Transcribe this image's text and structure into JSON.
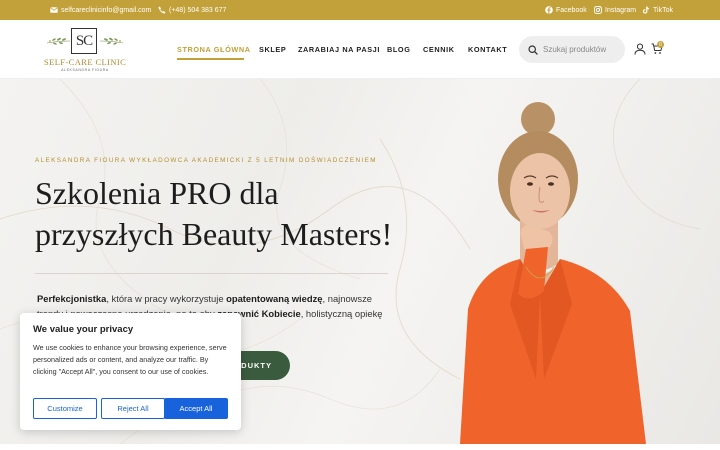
{
  "topbar": {
    "email": "selfcareclinicinfo@gmail.com",
    "phone": "(+48) 504 383 677",
    "social": [
      {
        "label": "Facebook",
        "icon": "facebook-icon"
      },
      {
        "label": "Instagram",
        "icon": "instagram-icon"
      },
      {
        "label": "TikTok",
        "icon": "tiktok-icon"
      }
    ]
  },
  "header": {
    "logo": {
      "monogram": "SC",
      "name": "SELF-CARE CLINIC",
      "sub": "ALEKSANDRA FIOURA"
    },
    "nav": [
      {
        "label": "STRONA GŁÓWNA",
        "active": true
      },
      {
        "label": "SKLEP"
      },
      {
        "label": "ZARABIAJ NA PASJI"
      },
      {
        "label": "BLOG"
      },
      {
        "label": "CENNIK"
      },
      {
        "label": "KONTAKT"
      }
    ],
    "search_placeholder": "Szukaj produktów",
    "cart_count": "0"
  },
  "hero": {
    "eyebrow": "ALEKSANDRA FIOURA WYKŁADOWCA AKADEMICKI Z 5 LETNIM DOŚWIADCZENIEM",
    "title_line1": "Szkolenia PRO dla",
    "title_line2": "przyszłych Beauty Masters!",
    "desc_bold1": "Perfekcjonistka",
    "desc_t1": ", która w pracy wykorzystuje ",
    "desc_bold2": "opatentowaną wiedzę",
    "desc_t2": ", najnowsze trendy i nowoczesne urządzenia, po to aby ",
    "desc_bold3": "zapewnić Kobiecie",
    "desc_t3": ", holistyczną opiekę i przywrócić radość z dbania o Siebie.",
    "button": "PRODUKTY"
  },
  "cookie": {
    "title": "We value your privacy",
    "text": "We use cookies to enhance your browsing experience, serve personalized ads or content, and analyze our traffic. By clicking \"Accept All\", you consent to our use of cookies.",
    "customize": "Customize",
    "reject": "Reject All",
    "accept": "Accept All"
  },
  "colors": {
    "gold": "#c2a13a",
    "green": "#3b5b3e",
    "blue": "#1863dc"
  }
}
